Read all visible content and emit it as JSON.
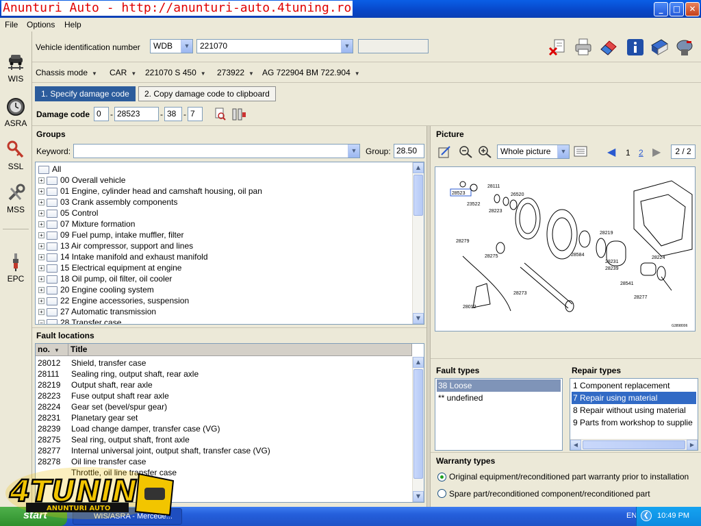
{
  "window": {
    "title": "Anunturi Auto - http://anunturi-auto.4tuning.ro",
    "min": "_",
    "max": "□",
    "close": "✕"
  },
  "menu": [
    "File",
    "Options",
    "Help"
  ],
  "nav": {
    "items": [
      {
        "label": "WIS",
        "icon": "car-lift-icon"
      },
      {
        "label": "ASRA",
        "icon": "clock-icon"
      },
      {
        "label": "SSL",
        "icon": "key-wrench-icon"
      },
      {
        "label": "MSS",
        "icon": "wrench-icon"
      },
      {
        "label": "EPC",
        "icon": "spark-plug-icon"
      }
    ]
  },
  "vehicle": {
    "vin_label": "Vehicle identification number",
    "vin_prefix": "WDB",
    "vin_number": "221070",
    "vin_extra": ""
  },
  "toolbar_icons": [
    "delete-document-icon",
    "printer-icon",
    "eraser-icon",
    "info-icon",
    "manual-book-icon",
    "mailbox-icon"
  ],
  "chassis": {
    "mode_label": "Chassis mode",
    "type": "CAR",
    "model": "221070 S 450",
    "engine": "273922",
    "transmission": "AG 722904 BM 722.904"
  },
  "tabs": [
    {
      "label": "1. Specify damage code",
      "active": true
    },
    {
      "label": "2. Copy damage code to clipboard",
      "active": false
    }
  ],
  "damage_code": {
    "label": "Damage code",
    "parts": [
      "0",
      "28523",
      "38",
      "7"
    ],
    "sep": "-"
  },
  "groups": {
    "title": "Groups",
    "keyword_label": "Keyword:",
    "keyword_value": "",
    "group_label": "Group:",
    "group_value": "28.50",
    "tree": [
      {
        "code": "All",
        "label": "",
        "root": true
      },
      {
        "code": "00",
        "label": "Overall vehicle"
      },
      {
        "code": "01",
        "label": "Engine, cylinder head and camshaft housing, oil pan"
      },
      {
        "code": "03",
        "label": "Crank assembly components"
      },
      {
        "code": "05",
        "label": "Control"
      },
      {
        "code": "07",
        "label": "Mixture formation"
      },
      {
        "code": "09",
        "label": "Fuel pump, intake muffler, filter"
      },
      {
        "code": "13",
        "label": "Air compressor, support and lines"
      },
      {
        "code": "14",
        "label": "Intake manifold and exhaust manifold"
      },
      {
        "code": "15",
        "label": "Electrical equipment at engine"
      },
      {
        "code": "18",
        "label": "Oil pump, oil filter, oil cooler"
      },
      {
        "code": "20",
        "label": "Engine cooling system"
      },
      {
        "code": "22",
        "label": "Engine accessories, suspension"
      },
      {
        "code": "27",
        "label": "Automatic transmission"
      },
      {
        "code": "28",
        "label": "Transfer case"
      }
    ]
  },
  "fault_locations": {
    "title": "Fault locations",
    "col_no": "no.",
    "col_title": "Title",
    "rows": [
      {
        "no": "28012",
        "title": "Shield, transfer case"
      },
      {
        "no": "28111",
        "title": "Sealing ring, output shaft, rear axle"
      },
      {
        "no": "28219",
        "title": "Output shaft, rear axle"
      },
      {
        "no": "28223",
        "title": "Fuse output shaft rear axle"
      },
      {
        "no": "28224",
        "title": "Gear set (bevel/spur gear)"
      },
      {
        "no": "28231",
        "title": "Planetary gear set"
      },
      {
        "no": "28239",
        "title": "Load change damper, transfer case (VG)"
      },
      {
        "no": "28275",
        "title": "Seal ring, output shaft, front axle"
      },
      {
        "no": "28277",
        "title": "Internal universal joint, output shaft, transfer case (VG)"
      },
      {
        "no": "28278",
        "title": "Oil line transfer case"
      },
      {
        "no": "",
        "title": "Throttle, oil line transfer case"
      }
    ]
  },
  "picture": {
    "title": "Picture",
    "view": "Whole picture",
    "page_1": "1",
    "page_2": "2",
    "page_counter": "2 / 2",
    "parts": [
      "28523",
      "28111",
      "23522",
      "28223",
      "26520",
      "28279",
      "28275",
      "28219",
      "28584",
      "28231",
      "28239",
      "28224",
      "28541",
      "28277",
      "28273",
      "28012"
    ],
    "ref": "G3898006"
  },
  "fault_types": {
    "title": "Fault types",
    "items": [
      {
        "label": "38  Loose",
        "selected": true
      },
      {
        "label": "**  undefined",
        "selected": false
      }
    ]
  },
  "repair_types": {
    "title": "Repair types",
    "items": [
      {
        "label": "1  Component replacement",
        "selected": false
      },
      {
        "label": "7  Repair using material",
        "selected": true
      },
      {
        "label": "8  Repair without using material",
        "selected": false
      },
      {
        "label": "9  Parts from workshop to supplie",
        "selected": false
      }
    ]
  },
  "warranty": {
    "title": "Warranty types",
    "options": [
      {
        "label": "Original equipment/reconditioned part warranty prior to installation",
        "selected": true
      },
      {
        "label": "Spare part/reconditioned component/reconditioned part",
        "selected": false
      }
    ]
  },
  "taskbar": {
    "start": "start",
    "task": "WIS/ASRA - Mercede...",
    "lang": "EN",
    "time": "10:49 PM"
  },
  "watermark": {
    "brand": "4TUNING",
    "sub": "ANUNTURI AUTO"
  },
  "colors": {
    "accent_blue": "#2c5c9c",
    "selection": "#316ac5",
    "titlebar": "#0a5fe6",
    "error_red": "#e00000"
  }
}
